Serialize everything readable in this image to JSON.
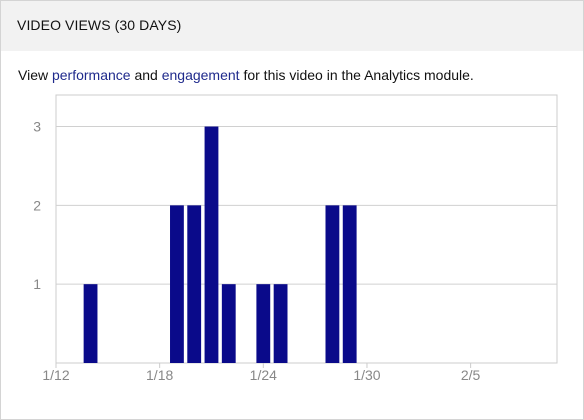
{
  "panel": {
    "title": "VIDEO VIEWS (30 DAYS)",
    "intro": {
      "prefix": "View ",
      "link1": "performance",
      "middle": " and ",
      "link2": "engagement",
      "suffix": " for this video in the Analytics module."
    }
  },
  "chart_data": {
    "type": "bar",
    "x": [
      "1/14",
      "1/19",
      "1/20",
      "1/21",
      "1/22",
      "1/24",
      "1/25",
      "1/28",
      "1/29"
    ],
    "values": [
      1,
      2,
      2,
      3,
      1,
      1,
      1,
      2,
      2
    ],
    "x_ticks": [
      "1/12",
      "1/18",
      "1/24",
      "1/30",
      "2/5"
    ],
    "y_ticks": [
      "1",
      "2",
      "3"
    ],
    "ylim": [
      0,
      3.4
    ],
    "xlim": [
      "1/12",
      "2/10"
    ],
    "grid": true,
    "bar_color": "#0a0a8a"
  }
}
